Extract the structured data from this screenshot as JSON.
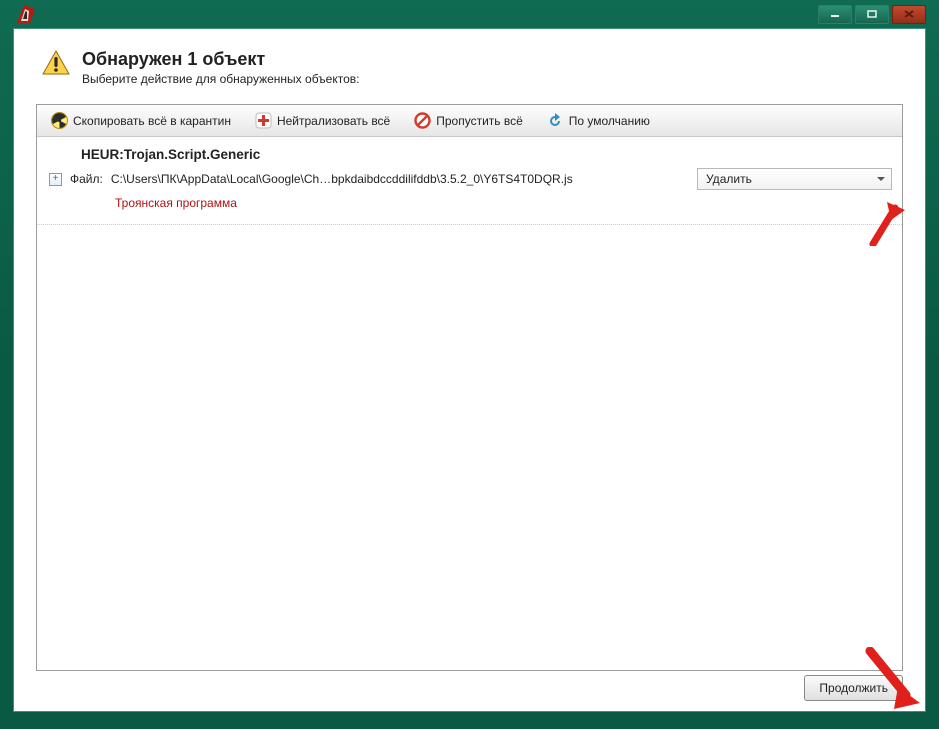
{
  "header": {
    "title": "Обнаружен 1  объект",
    "subtitle": "Выберите действие для обнаруженных объектов:"
  },
  "toolbar": {
    "quarantine": "Скопировать всё в карантин",
    "neutralize": "Нейтрализовать всё",
    "skip": "Пропустить всё",
    "reset": "По умолчанию"
  },
  "threat": {
    "name": "HEUR:Trojan.Script.Generic",
    "file_label": "Файл:",
    "file_path": "C:\\Users\\ПК\\AppData\\Local\\Google\\Ch…bpkdaibdccddilifddb\\3.5.2_0\\Y6TS4T0DQR.js",
    "action_selected": "Удалить",
    "type": "Троянская программа"
  },
  "footer": {
    "continue": "Продолжить"
  }
}
